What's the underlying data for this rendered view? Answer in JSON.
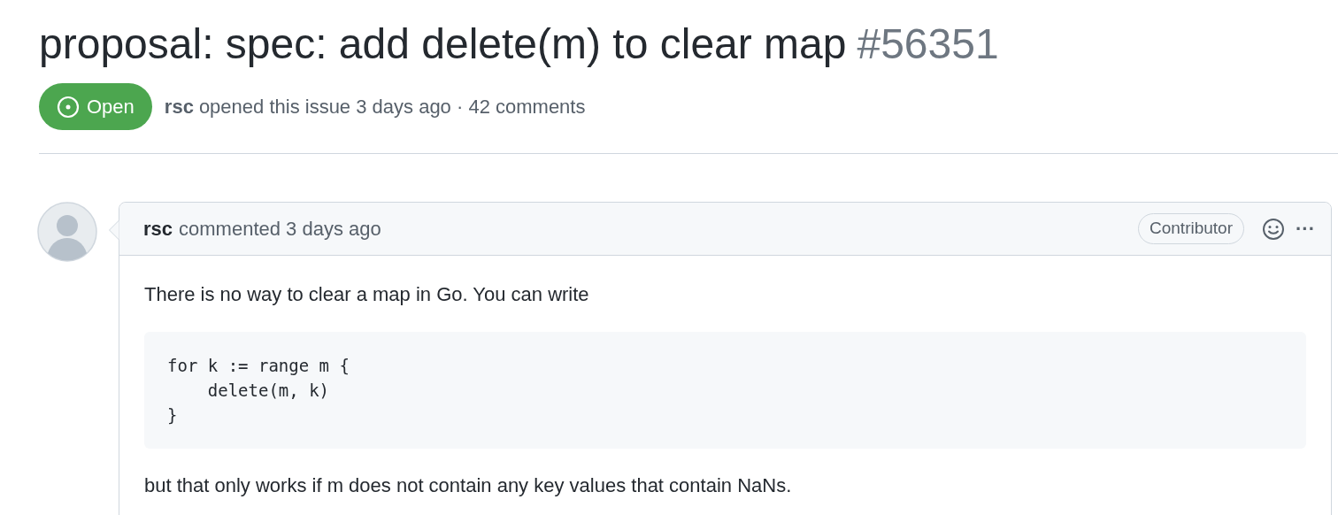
{
  "issue": {
    "title": "proposal: spec: add delete(m) to clear map",
    "number": "#56351",
    "state": {
      "kind": "open",
      "label": "Open"
    },
    "author": "rsc",
    "meta": "opened this issue 3 days ago · 42 comments"
  },
  "comment": {
    "author": "rsc",
    "meta": "commented 3 days ago",
    "role": "Contributor",
    "more": "···",
    "body": [
      {
        "kind": "text",
        "text": "There is no way to clear a map in Go. You can write"
      },
      {
        "kind": "code",
        "lines": [
          "for k := range m {",
          "    delete(m, k)",
          "}"
        ]
      },
      {
        "kind": "text",
        "text": "but that only works if m does not contain any key values that contain NaNs."
      }
    ]
  }
}
